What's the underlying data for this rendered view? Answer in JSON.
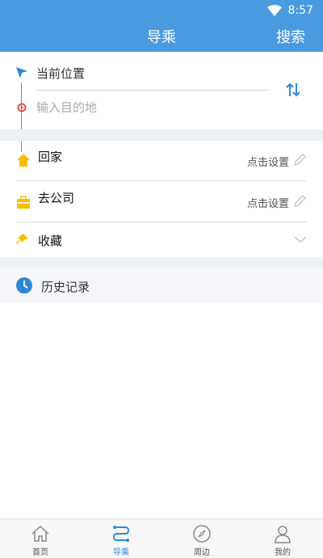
{
  "status": {
    "time": "8:57",
    "icons": [
      "wifi-icon"
    ]
  },
  "header": {
    "title": "导乘",
    "search_label": "搜索"
  },
  "route": {
    "from_label": "当前位置",
    "to_placeholder": "输入目的地"
  },
  "shortcuts": [
    {
      "label": "回家",
      "action": "点击设置",
      "icon": "home-icon"
    },
    {
      "label": "去公司",
      "action": "点击设置",
      "icon": "briefcase-icon"
    },
    {
      "label": "收藏",
      "icon": "pin-icon"
    }
  ],
  "history": {
    "label": "历史记录"
  },
  "tabbar": {
    "items": [
      {
        "label": "首页",
        "icon": "home-outline-icon"
      },
      {
        "label": "导乘",
        "icon": "route-icon",
        "active": true
      },
      {
        "label": "周边",
        "icon": "compass-icon"
      },
      {
        "label": "我的",
        "icon": "user-icon"
      }
    ]
  },
  "colors": {
    "primary": "#4a9ae0",
    "active_tab": "#2a8be0",
    "home_icon": "#f5c000",
    "section_bg": "#eef0f7"
  }
}
